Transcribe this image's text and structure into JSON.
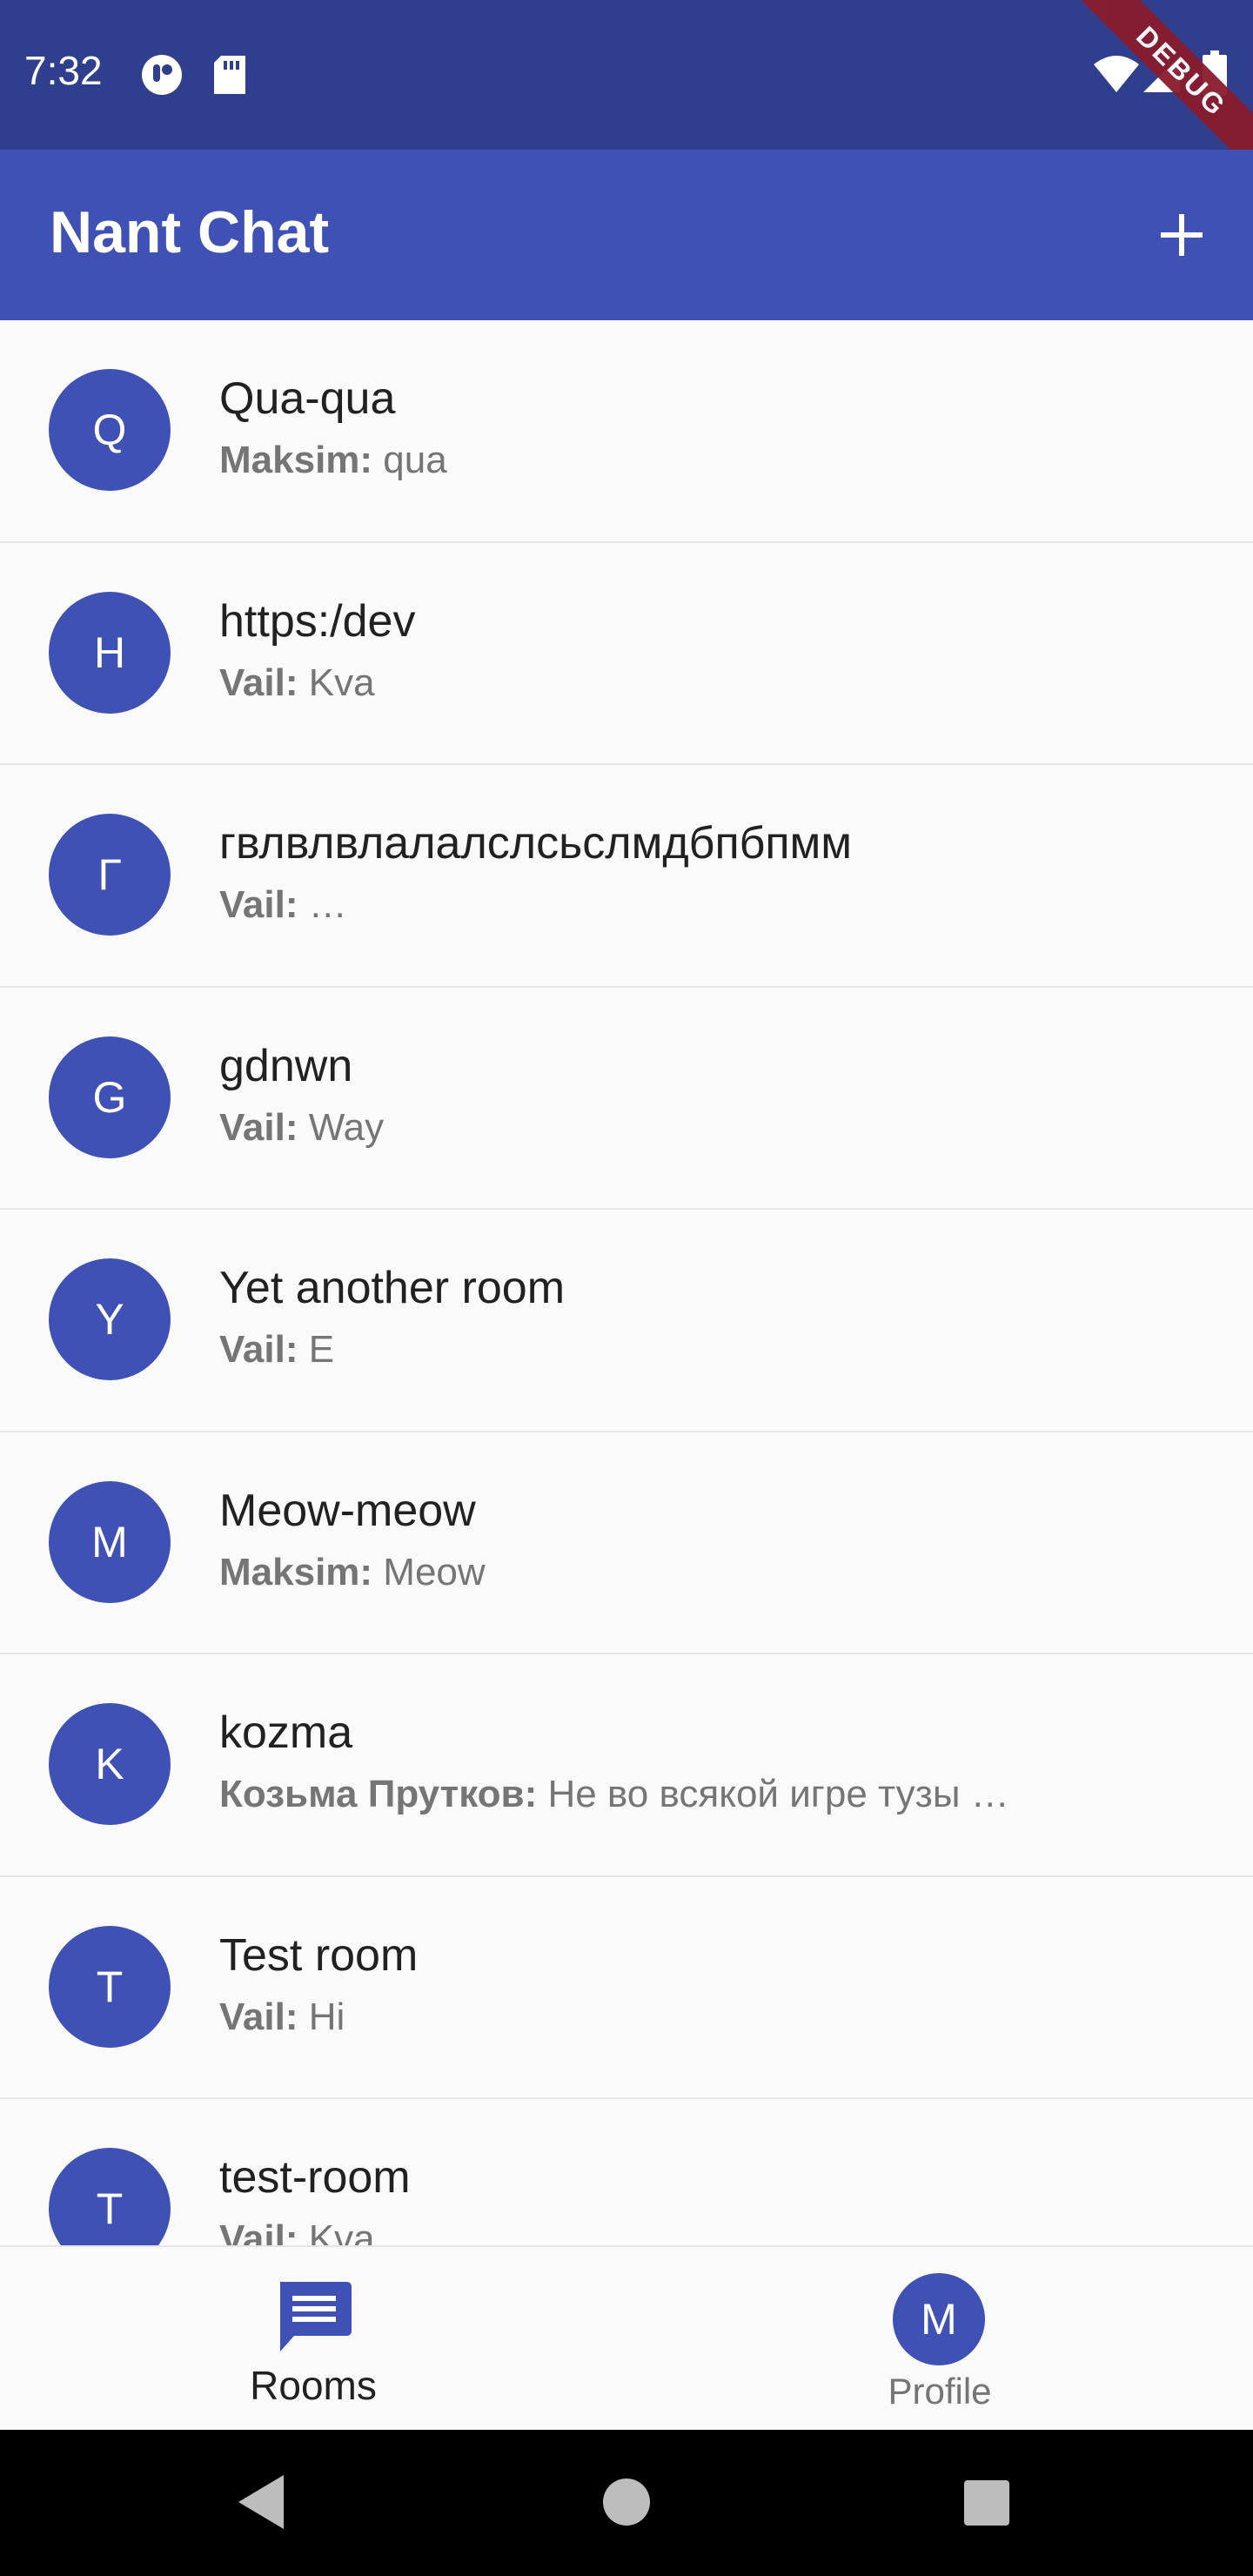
{
  "status_bar": {
    "time": "7:32",
    "debug_label": "DEBUG",
    "icons": [
      "app-notification-icon",
      "sd-card-icon",
      "wifi-icon",
      "signal-icon",
      "battery-icon"
    ]
  },
  "app_bar": {
    "title": "Nant Chat",
    "add_icon": "plus-icon"
  },
  "rooms": [
    {
      "initial": "Q",
      "name": "Qua-qua",
      "sender": "Maksim:",
      "message": " qua"
    },
    {
      "initial": "H",
      "name": "https:/dev",
      "sender": "Vail:",
      "message": " Kva"
    },
    {
      "initial": "Г",
      "name": "гвлвлвлалалслсьслмдбпбпмм",
      "sender": "Vail:",
      "message": " …"
    },
    {
      "initial": "G",
      "name": "gdnwn",
      "sender": "Vail:",
      "message": " Way"
    },
    {
      "initial": "Y",
      "name": "Yet another room",
      "sender": "Vail:",
      "message": " E"
    },
    {
      "initial": "M",
      "name": "Meow-meow",
      "sender": "Maksim:",
      "message": " Meow"
    },
    {
      "initial": "K",
      "name": "kozma",
      "sender": "Козьма Прутков:",
      "message": " Не во всякой игре тузы …"
    },
    {
      "initial": "T",
      "name": "Test room",
      "sender": "Vail:",
      "message": " Hi"
    },
    {
      "initial": "T",
      "name": "test-room",
      "sender": "Vail:",
      "message": " Kva"
    }
  ],
  "bottom_nav": {
    "rooms_label": "Rooms",
    "profile_label": "Profile",
    "profile_initial": "M"
  },
  "colors": {
    "primary": "#3f51b5",
    "status_bar": "#303f8d",
    "debug_ribbon": "#8a1c2e",
    "background": "#fafafa"
  }
}
